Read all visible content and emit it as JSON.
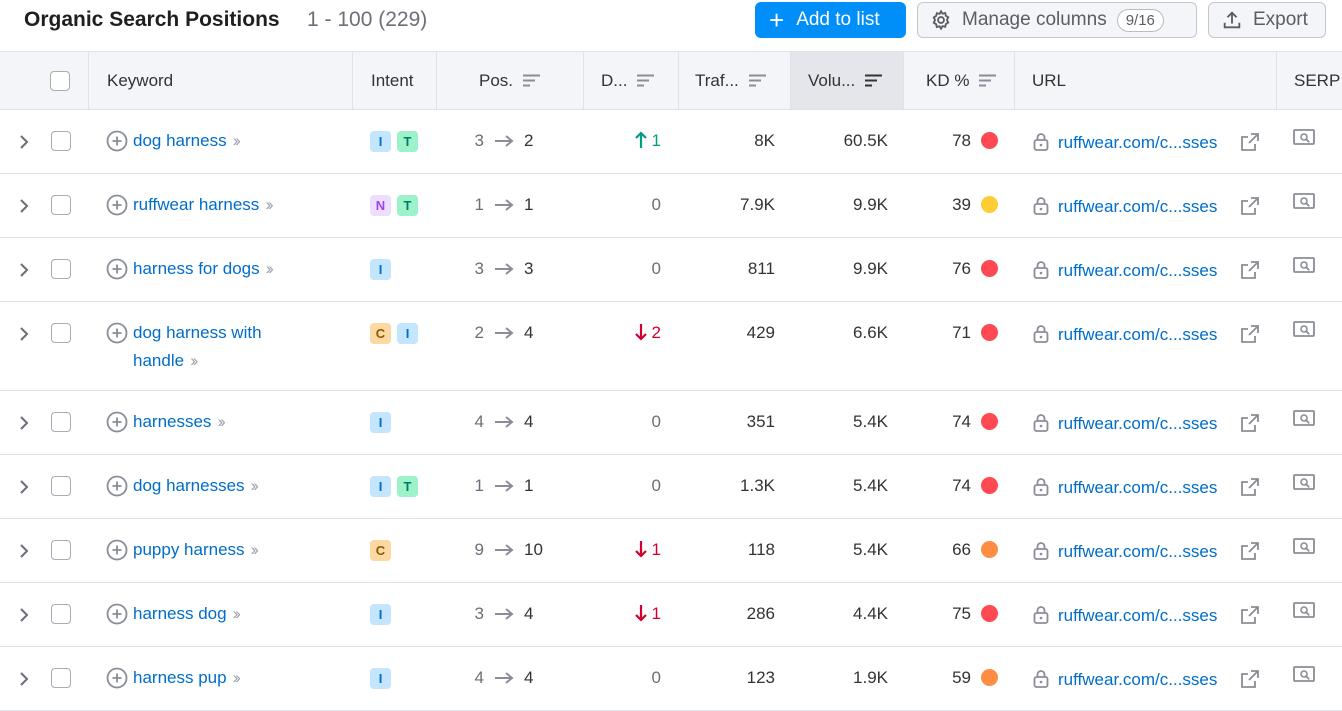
{
  "header": {
    "title": "Organic Search Positions",
    "range": "1 - 100 (229)",
    "add_label": "Add to list",
    "manage_label": "Manage columns",
    "manage_count": "9/16",
    "export_label": "Export"
  },
  "columns": {
    "keyword": "Keyword",
    "intent": "Intent",
    "pos": "Pos.",
    "diff": "D...",
    "traffic": "Traf...",
    "volume": "Volu...",
    "kd": "KD %",
    "url": "URL",
    "serp": "SERP"
  },
  "colors": {
    "link": "#006dca",
    "accent": "#008ff8",
    "kd_red": "#ff4953",
    "kd_yellow": "#ffcc33",
    "kd_orange": "#ff8c43",
    "up": "#009f81",
    "down": "#d1002f"
  },
  "intent_styles": {
    "I": {
      "bg": "#c4e5fe",
      "fg": "#006dca"
    },
    "T": {
      "bg": "#9ef2c9",
      "fg": "#007c65"
    },
    "N": {
      "bg": "#eddeff",
      "fg": "#9a45f0"
    },
    "C": {
      "bg": "#fcd8a3",
      "fg": "#8a5a00"
    }
  },
  "rows": [
    {
      "keyword": [
        "dog harness"
      ],
      "intents": [
        "I",
        "T"
      ],
      "pos_from": "3",
      "pos_to": "2",
      "diff": "1",
      "diff_dir": "up",
      "traffic": "8K",
      "volume": "60.5K",
      "kd": "78",
      "kd_color": "#ff4953",
      "url": "ruffwear.com/c...sses"
    },
    {
      "keyword": [
        "ruffwear harness"
      ],
      "intents": [
        "N",
        "T"
      ],
      "pos_from": "1",
      "pos_to": "1",
      "diff": "0",
      "diff_dir": "none",
      "traffic": "7.9K",
      "volume": "9.9K",
      "kd": "39",
      "kd_color": "#ffcc33",
      "url": "ruffwear.com/c...sses"
    },
    {
      "keyword": [
        "harness for dogs"
      ],
      "intents": [
        "I"
      ],
      "pos_from": "3",
      "pos_to": "3",
      "diff": "0",
      "diff_dir": "none",
      "traffic": "811",
      "volume": "9.9K",
      "kd": "76",
      "kd_color": "#ff4953",
      "url": "ruffwear.com/c...sses"
    },
    {
      "keyword": [
        "dog harness with",
        "handle"
      ],
      "intents": [
        "C",
        "I"
      ],
      "pos_from": "2",
      "pos_to": "4",
      "diff": "2",
      "diff_dir": "down",
      "traffic": "429",
      "volume": "6.6K",
      "kd": "71",
      "kd_color": "#ff4953",
      "url": "ruffwear.com/c...sses"
    },
    {
      "keyword": [
        "harnesses"
      ],
      "intents": [
        "I"
      ],
      "pos_from": "4",
      "pos_to": "4",
      "diff": "0",
      "diff_dir": "none",
      "traffic": "351",
      "volume": "5.4K",
      "kd": "74",
      "kd_color": "#ff4953",
      "url": "ruffwear.com/c...sses"
    },
    {
      "keyword": [
        "dog harnesses"
      ],
      "intents": [
        "I",
        "T"
      ],
      "pos_from": "1",
      "pos_to": "1",
      "diff": "0",
      "diff_dir": "none",
      "traffic": "1.3K",
      "volume": "5.4K",
      "kd": "74",
      "kd_color": "#ff4953",
      "url": "ruffwear.com/c...sses"
    },
    {
      "keyword": [
        "puppy harness"
      ],
      "intents": [
        "C"
      ],
      "pos_from": "9",
      "pos_to": "10",
      "diff": "1",
      "diff_dir": "down",
      "traffic": "118",
      "volume": "5.4K",
      "kd": "66",
      "kd_color": "#ff8c43",
      "url": "ruffwear.com/c...sses"
    },
    {
      "keyword": [
        "harness dog"
      ],
      "intents": [
        "I"
      ],
      "pos_from": "3",
      "pos_to": "4",
      "diff": "1",
      "diff_dir": "down",
      "traffic": "286",
      "volume": "4.4K",
      "kd": "75",
      "kd_color": "#ff4953",
      "url": "ruffwear.com/c...sses"
    },
    {
      "keyword": [
        "harness pup"
      ],
      "intents": [
        "I"
      ],
      "pos_from": "4",
      "pos_to": "4",
      "diff": "0",
      "diff_dir": "none",
      "traffic": "123",
      "volume": "1.9K",
      "kd": "59",
      "kd_color": "#ff8c43",
      "url": "ruffwear.com/c...sses"
    }
  ]
}
